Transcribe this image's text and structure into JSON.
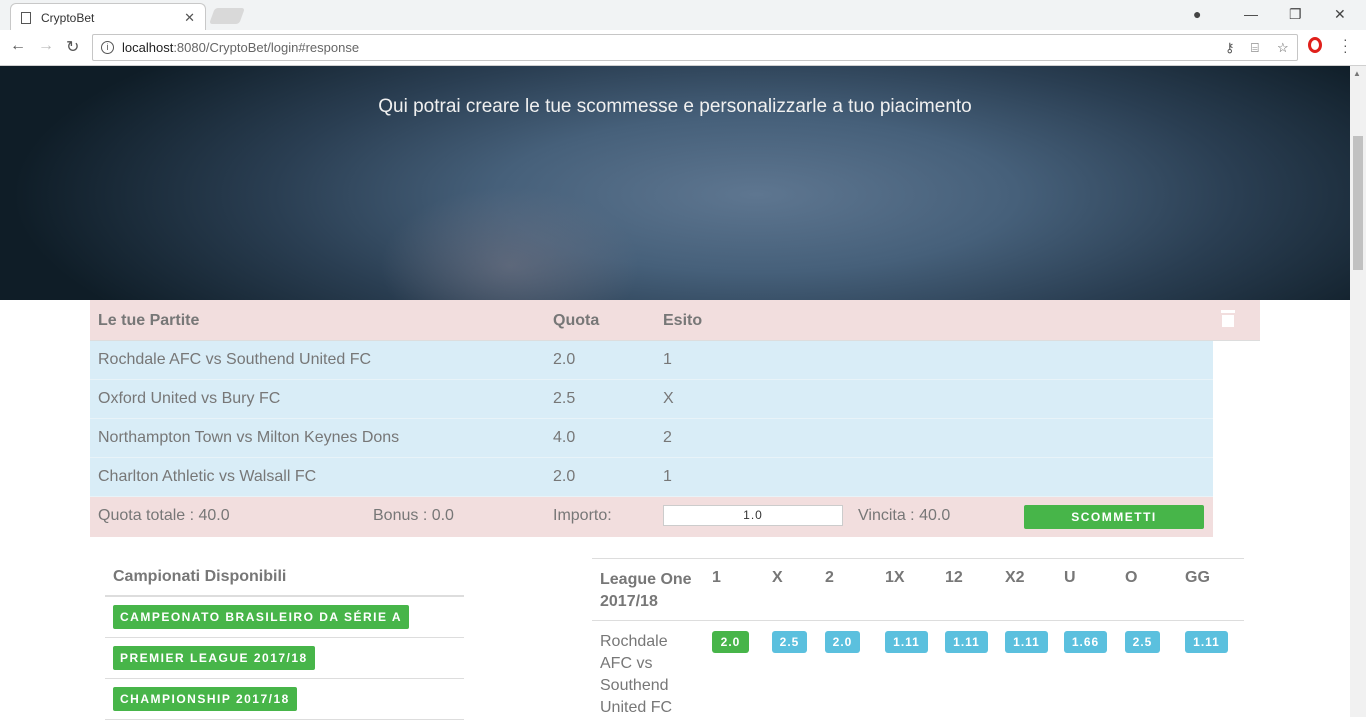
{
  "browser": {
    "tab_title": "CryptoBet",
    "url_host": "localhost",
    "url_path": ":8080/CryptoBet/login#response"
  },
  "hero": {
    "subtitle": "Qui potrai creare le tue scommesse e personalizzarle a tuo piacimento"
  },
  "slip": {
    "headers": {
      "match": "Le tue Partite",
      "quota": "Quota",
      "esito": "Esito"
    },
    "rows": [
      {
        "match": "Rochdale AFC vs Southend United FC",
        "quota": "2.0",
        "esito": "1"
      },
      {
        "match": "Oxford United vs Bury FC",
        "quota": "2.5",
        "esito": "X"
      },
      {
        "match": "Northampton Town vs Milton Keynes Dons",
        "quota": "4.0",
        "esito": "2"
      },
      {
        "match": "Charlton Athletic vs Walsall FC",
        "quota": "2.0",
        "esito": "1"
      }
    ],
    "footer": {
      "quota_totale": "Quota totale : 40.0",
      "bonus": "Bonus : 0.0",
      "importo_label": "Importo:",
      "importo_value": "1.0",
      "vincita": "Vincita : 40.0",
      "submit_label": "SCOMMETTI"
    }
  },
  "leagues": {
    "title": "Campionati Disponibili",
    "items": [
      {
        "label": "CAMPEONATO BRASILEIRO DA SÉRIE A"
      },
      {
        "label": "PREMIER LEAGUE 2017/18"
      },
      {
        "label": "CHAMPIONSHIP 2017/18"
      }
    ]
  },
  "odds": {
    "league_title": "League One 2017/18",
    "columns": [
      "1",
      "X",
      "2",
      "1X",
      "12",
      "X2",
      "U",
      "O",
      "GG"
    ],
    "rows": [
      {
        "match": "Rochdale AFC vs Southend United FC",
        "values": [
          "2.0",
          "2.5",
          "2.0",
          "1.11",
          "1.11",
          "1.11",
          "1.66",
          "2.5",
          "1.11"
        ],
        "selected_index": 0
      }
    ]
  },
  "colors": {
    "accent_green": "#47b549",
    "odds_blue": "#5bc0de",
    "slip_pink": "#f2dede",
    "slip_blue": "#d9edf7"
  }
}
